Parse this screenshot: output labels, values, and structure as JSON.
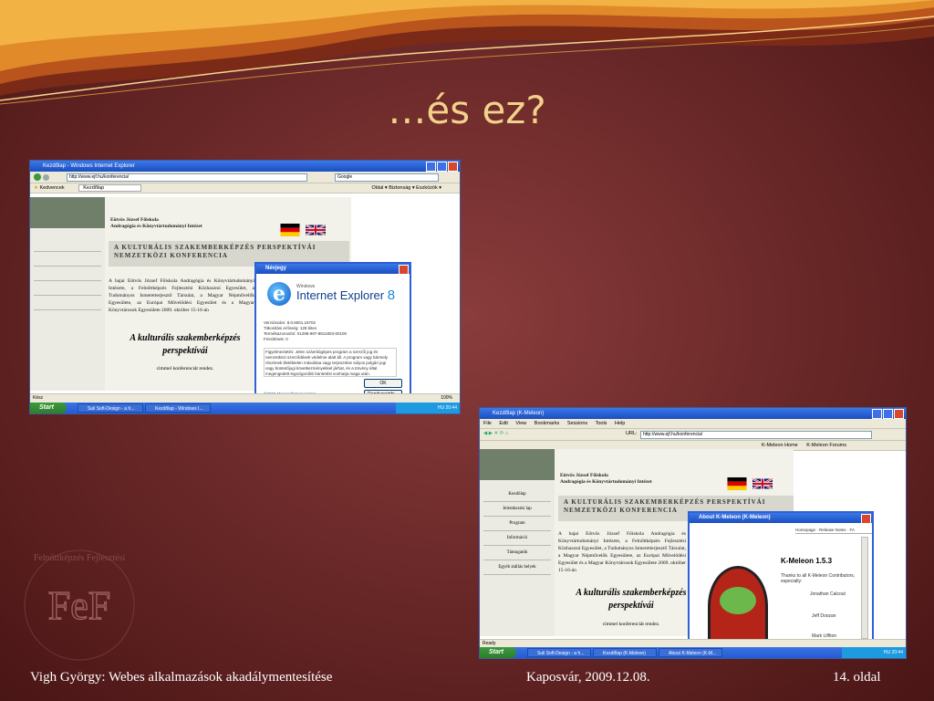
{
  "slide": {
    "title": "…és ez?",
    "footer_left": "Vigh György: Webes alkalmazások akadálymentesítése",
    "footer_center": "Kaposvár, 2009.12.08.",
    "footer_right": "14. oldal",
    "logo_text": "FeF",
    "logo_ring": "Felnőttképzés Fejlesztési"
  },
  "colors": {
    "title": "#f2d28a",
    "xp_blue": "#2f61d6",
    "start_green": "#2e7d2e",
    "sidebar_dark": "#707f6a"
  },
  "ie": {
    "window_title": "Kezdőlap - Windows Internet Explorer",
    "address": "http://www.ejf.hu/konferencia/",
    "search_placeholder": "Google",
    "favorites": "Kedvencek",
    "tab": "Kezdőlap",
    "toolbar_right": "Oldal ▾  Biztonság ▾  Eszközök ▾",
    "status": "Kész",
    "zoom": "100%",
    "dialog": {
      "title": "Névjegy",
      "brand_small": "Windows",
      "brand": "Internet Explorer",
      "version_num": "8",
      "info": [
        "Verziószám: 8.0.6001.18702",
        "Titkosítási erősség: 128 bites",
        "Termékazonosító: 01298-997-8811803-00100",
        "Frissítések: 0"
      ],
      "notice": "Figyelmeztetés: Jelen számítógépes program a szerzői jog és nemzetközi szerződések védelme alatt áll. A program vagy bármely részének illetéktelen másolása vagy terjesztése súlyos polgári jogi vagy büntetőjogi következményekkel járhat, és a törvény által megengedett legszigorúbb büntetést vonhatja maga után.",
      "ok": "OK",
      "copyright": "©2009 Microsoft Corporation",
      "sysinfo": "Rendszerinfo..."
    },
    "taskbar": {
      "start": "Start",
      "tasks": [
        "Suli Soft-Design - a h...",
        "Kezdőlap - Windows I..."
      ],
      "tray": "HU  20:44"
    }
  },
  "kmeleon": {
    "window_title": "Kezdőlap (K-Meleon)",
    "menu": [
      "File",
      "Edit",
      "View",
      "Bookmarks",
      "Sessions",
      "Tools",
      "Help"
    ],
    "url_label": "URL:",
    "address": "http://www.ejf.hu/konferencia/",
    "links": [
      "K-Meleon Home",
      "K-Meleon Forums"
    ],
    "status": "Ready",
    "dialog": {
      "title": "About K-Meleon (K-Meleon)",
      "tabs": "Homepage · Release Notes · FA",
      "version": "K-Meleon 1.5.3",
      "thanks": "Thanks to all K-Meleon Contributors, especially:",
      "names": [
        "Jonathan Calcout",
        "Jeff Doozan",
        "Mark Liffiton"
      ]
    },
    "taskbar": {
      "start": "Start",
      "tasks": [
        "Suli Soft-Design - a h...",
        "Kezdőlap (K-Meleon)",
        "About K-Meleon (K-M..."
      ],
      "tray": "HU  20:44"
    }
  },
  "page": {
    "institution_line1": "Eötvös József Főiskola",
    "institution_line2": "Andragógia és Könyvtártudományi Intézet",
    "conf_title_line1": "A KULTURÁLIS SZAKEMBERKÉPZÉS PERSPEKTÍVÁI",
    "conf_title_line2": "NEMZETKÖZI KONFERENCIA",
    "body": "A bajai Eötvös József Főiskola Andragógia és Könyvtártudományi Intézete, a Felnőttképzés Fejlesztési Közhasznú Egyesület, a Tudományos Ismeretterjesztő Társulat, a Magyar Népművelők Egyesülete, az Európai Művelődési Egyesület és a Magyar Könyvtárosok Egyesülete 2009. október 15-16-án",
    "italic_line1": "A kulturális szakemberképzés",
    "italic_line2": "perspektívái",
    "subtitle": "címmel konferenciát rendez.",
    "nav": [
      "Kezdőlap",
      "Jelentkezési lap",
      "Program",
      "Információ",
      "Támogatók",
      "Egyéb ztállás helyek"
    ]
  }
}
